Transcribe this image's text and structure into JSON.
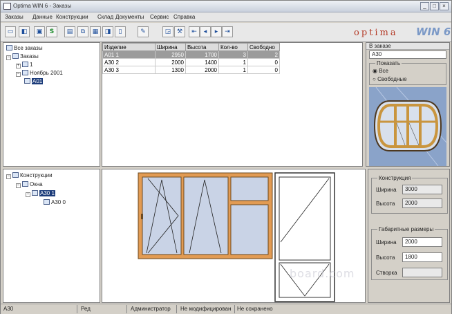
{
  "window": {
    "title": "Optima WIN 6 - Заказы",
    "controls": [
      "_",
      "□",
      "×"
    ]
  },
  "menu": [
    "Заказы",
    "Данные",
    "Конструкции",
    "Склад",
    "Документы",
    "Сервис",
    "Справка"
  ],
  "toolbar": {
    "buttons": [
      "new",
      "open",
      "save",
      "settings",
      "print",
      "copy",
      "paste",
      "cut",
      "report",
      "edit",
      "move",
      "nav"
    ],
    "s_label": "S"
  },
  "brand": {
    "word": "optima",
    "version": "WIN 6"
  },
  "orders_tree": {
    "items": [
      {
        "label": "Все заказы"
      },
      {
        "label": "Заказы"
      },
      {
        "label": "1"
      },
      {
        "label": "Ноябрь 2001"
      },
      {
        "label": "А01"
      }
    ]
  },
  "order_table": {
    "headers": [
      "Изделие",
      "Ширина",
      "Высота",
      "Кол-во",
      "Свободно"
    ],
    "rows": [
      {
        "name": "А01 1",
        "width": "2950",
        "height": "1700",
        "qty": "3",
        "free": "2"
      },
      {
        "name": "А30 2",
        "width": "2000",
        "height": "1400",
        "qty": "1",
        "free": "0"
      },
      {
        "name": "А30 3",
        "width": "1300",
        "height": "2000",
        "qty": "1",
        "free": "0"
      }
    ]
  },
  "right_panel": {
    "header": "В заказе",
    "value": "А30",
    "filter_caption": "Показать",
    "options": [
      "Все",
      "Свободные"
    ]
  },
  "construction_tree": {
    "items": [
      {
        "label": "Конструкции"
      },
      {
        "label": "Окна"
      },
      {
        "label": "А30 1"
      },
      {
        "label": "А30 0"
      }
    ]
  },
  "construction_group": {
    "caption": "Конструкция",
    "width_label": "Ширина",
    "width_value": "3000",
    "height_label": "Высота",
    "height_value": "2000"
  },
  "sizes_group": {
    "caption": "Габаритные размеры",
    "width_label": "Ширина",
    "width_value": "2000",
    "height_label": "Высота",
    "height_value": "1800",
    "third_label": "Створка",
    "third_value": ""
  },
  "status": [
    "А30",
    "Ред",
    "Администратор",
    "Не модифицирован",
    "Не сохранено"
  ],
  "watermark": "board.com",
  "colors": {
    "frame": "#e29b53",
    "glass": "#c9d3e6",
    "selection": "#1c3c7a"
  }
}
